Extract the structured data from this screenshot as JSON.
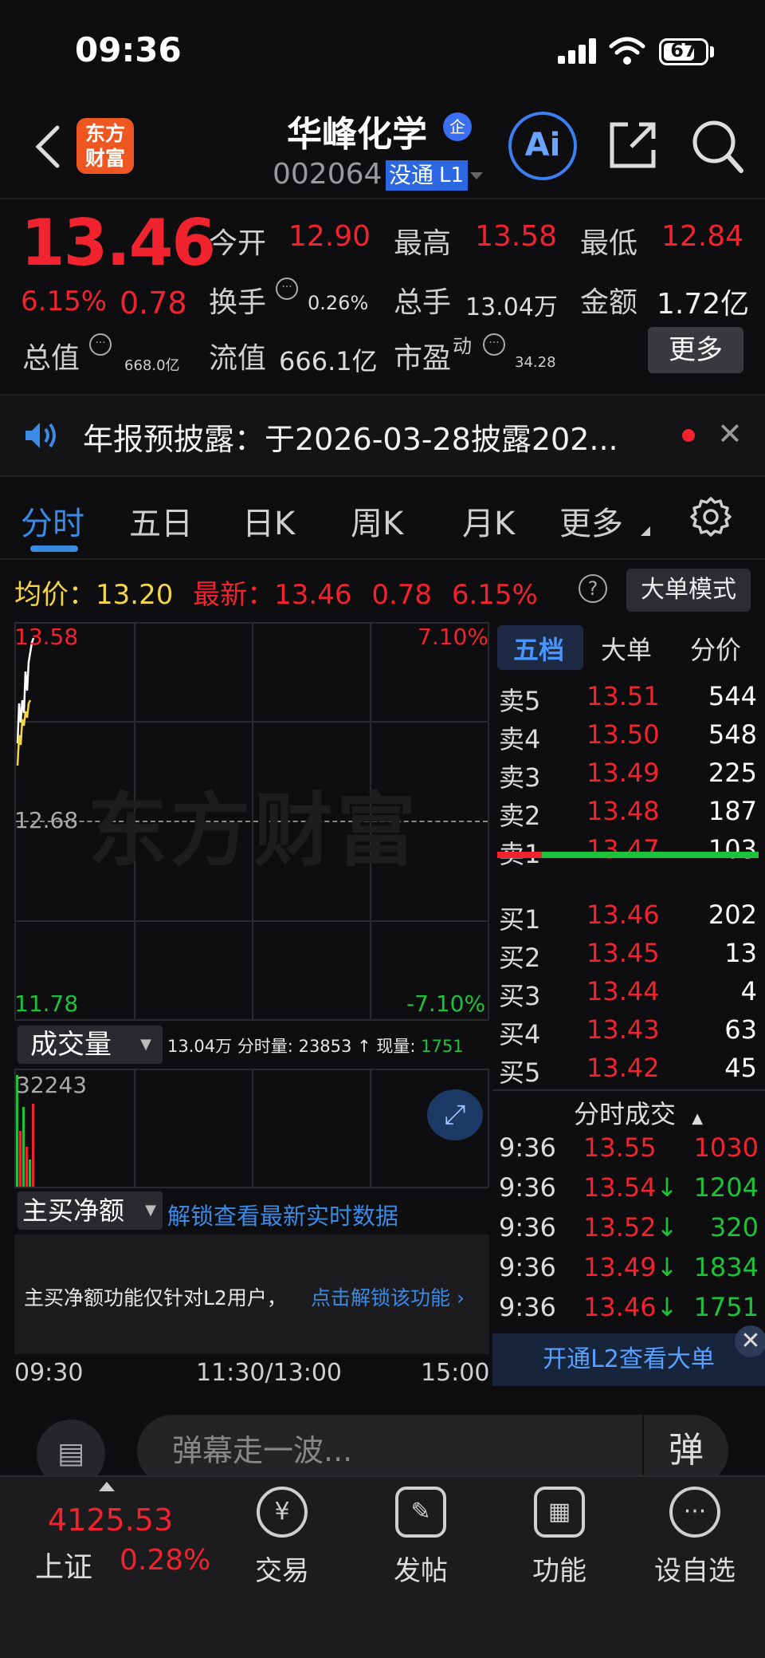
{
  "status_bar": {
    "time": "09:36",
    "battery": "67"
  },
  "header": {
    "logo_line1": "东方",
    "logo_line2": "财富",
    "stock_name": "华峰化学",
    "badge": "企",
    "stock_code": "002064",
    "code_tag1": "没通",
    "code_tag2": "L1",
    "ai_label": "Ai"
  },
  "quote": {
    "price": "13.46",
    "change_pct": "6.15%",
    "change": "0.78",
    "open_label": "今开",
    "open": "12.90",
    "high_label": "最高",
    "high": "13.58",
    "low_label": "最低",
    "low": "12.84",
    "turnover_label": "换手",
    "turnover": "0.26%",
    "volume_label": "总手",
    "volume": "13.04万",
    "amount_label": "金额",
    "amount": "1.72亿",
    "mktcap_label": "总值",
    "mktcap": "668.0亿",
    "float_label": "流值",
    "float": "666.1亿",
    "pe_label": "市盈",
    "pe_sup": "动",
    "pe": "34.28",
    "more_label": "更多"
  },
  "notice": {
    "text": "年报预披露：于2026-03-28披露202..."
  },
  "tabs": [
    "分时",
    "五日",
    "日K",
    "周K",
    "月K",
    "更多"
  ],
  "avg_row": {
    "avg_label": "均价：",
    "avg": "13.20",
    "latest_label": "最新：",
    "latest": "13.46",
    "change": "0.78",
    "pct": "6.15%",
    "bigorder_label": "大单模式"
  },
  "chart": {
    "hi": "13.58",
    "hi_pct": "7.10%",
    "mid": "12.68",
    "lo": "11.78",
    "lo_pct": "-7.10%",
    "watermark": "东方财富"
  },
  "volume": {
    "select_label": "成交量",
    "total": "13.04万",
    "period_label": "分时量:",
    "period": "23853",
    "now_label": "现量:",
    "now": "1751",
    "max": "32243"
  },
  "net_buy": {
    "select_label": "主买净额",
    "unlock": "解锁查看最新实时数据",
    "info": "主买净额功能仅针对L2用户，",
    "link": "点击解锁该功能"
  },
  "time_axis": [
    "09:30",
    "11:30/13:00",
    "15:00"
  ],
  "right_tabs": [
    "五档",
    "大单",
    "分价"
  ],
  "order_book": {
    "asks": [
      {
        "label": "卖5",
        "price": "13.51",
        "qty": "544"
      },
      {
        "label": "卖4",
        "price": "13.50",
        "qty": "548"
      },
      {
        "label": "卖3",
        "price": "13.49",
        "qty": "225"
      },
      {
        "label": "卖2",
        "price": "13.48",
        "qty": "187"
      },
      {
        "label": "卖1",
        "price": "13.47",
        "qty": "103"
      }
    ],
    "bids": [
      {
        "label": "买1",
        "price": "13.46",
        "qty": "202"
      },
      {
        "label": "买2",
        "price": "13.45",
        "qty": "13"
      },
      {
        "label": "买3",
        "price": "13.44",
        "qty": "4"
      },
      {
        "label": "买4",
        "price": "13.43",
        "qty": "63"
      },
      {
        "label": "买5",
        "price": "13.42",
        "qty": "45"
      }
    ]
  },
  "trades": {
    "title": "分时成交",
    "rows": [
      {
        "time": "9:36",
        "price": "13.55",
        "arrow": "",
        "qty": "1030",
        "color": "red"
      },
      {
        "time": "9:36",
        "price": "13.54",
        "arrow": "↓",
        "qty": "1204",
        "color": "green"
      },
      {
        "time": "9:36",
        "price": "13.52",
        "arrow": "↓",
        "qty": "320",
        "color": "green"
      },
      {
        "time": "9:36",
        "price": "13.49",
        "arrow": "↓",
        "qty": "1834",
        "color": "green"
      },
      {
        "time": "9:36",
        "price": "13.46",
        "arrow": "↓",
        "qty": "1751",
        "color": "green"
      }
    ],
    "l2_banner": "开通L2查看大单"
  },
  "comment": {
    "placeholder": "弹幕走一波...",
    "danmu": "弹"
  },
  "bottom_nav": {
    "index_value": "4125.53",
    "index_name": "上证",
    "index_pct": "0.28%",
    "items": [
      {
        "label": "交易",
        "icon": "¥"
      },
      {
        "label": "发帖",
        "icon": "✎"
      },
      {
        "label": "功能",
        "icon": "▦"
      },
      {
        "label": "设自选",
        "icon": "···"
      }
    ]
  },
  "colors": {
    "up": "#f0232e",
    "down": "#1ec23a",
    "accent": "#3b8be6",
    "avg": "#f3d547"
  }
}
